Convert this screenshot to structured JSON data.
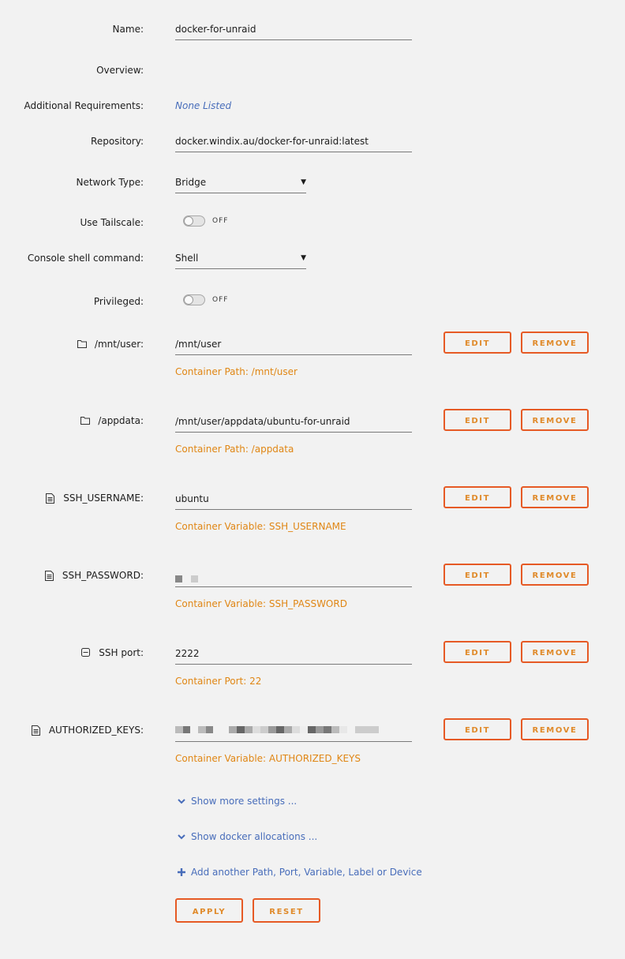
{
  "fields": {
    "name": {
      "label": "Name:",
      "value": "docker-for-unraid"
    },
    "overview": {
      "label": "Overview:"
    },
    "additional_requirements": {
      "label": "Additional Requirements:",
      "value": "None Listed"
    },
    "repository": {
      "label": "Repository:",
      "value": "docker.windix.au/docker-for-unraid:latest"
    },
    "network_type": {
      "label": "Network Type:",
      "value": "Bridge"
    },
    "use_tailscale": {
      "label": "Use Tailscale:",
      "state": "OFF"
    },
    "console_shell": {
      "label": "Console shell command:",
      "value": "Shell"
    },
    "privileged": {
      "label": "Privileged:",
      "state": "OFF"
    }
  },
  "entries": [
    {
      "label": "/mnt/user:",
      "icon": "folder-icon",
      "value": "/mnt/user",
      "sub": "Container Path: /mnt/user"
    },
    {
      "label": "/appdata:",
      "icon": "folder-icon",
      "value": "/mnt/user/appdata/ubuntu-for-unraid",
      "sub": "Container Path: /appdata"
    },
    {
      "label": "SSH_USERNAME:",
      "icon": "document-icon",
      "value": "ubuntu",
      "sub": "Container Variable: SSH_USERNAME"
    },
    {
      "label": "SSH_PASSWORD:",
      "icon": "document-icon",
      "value": "",
      "sub": "Container Variable: SSH_PASSWORD"
    },
    {
      "label": "SSH port:",
      "icon": "port-icon",
      "value": "2222",
      "sub": "Container Port: 22"
    },
    {
      "label": "AUTHORIZED_KEYS:",
      "icon": "document-icon",
      "value": "",
      "sub": "Container Variable: AUTHORIZED_KEYS"
    }
  ],
  "buttons": {
    "edit": "EDIT",
    "remove": "REMOVE",
    "apply": "APPLY",
    "reset": "RESET"
  },
  "links": {
    "show_more": "Show more settings ...",
    "show_docker": "Show docker allocations ...",
    "add_another": "Add another Path, Port, Variable, Label or Device"
  },
  "colors": {
    "accent": "#e65a25",
    "link": "#486dba",
    "sub_text": "#e08614"
  }
}
